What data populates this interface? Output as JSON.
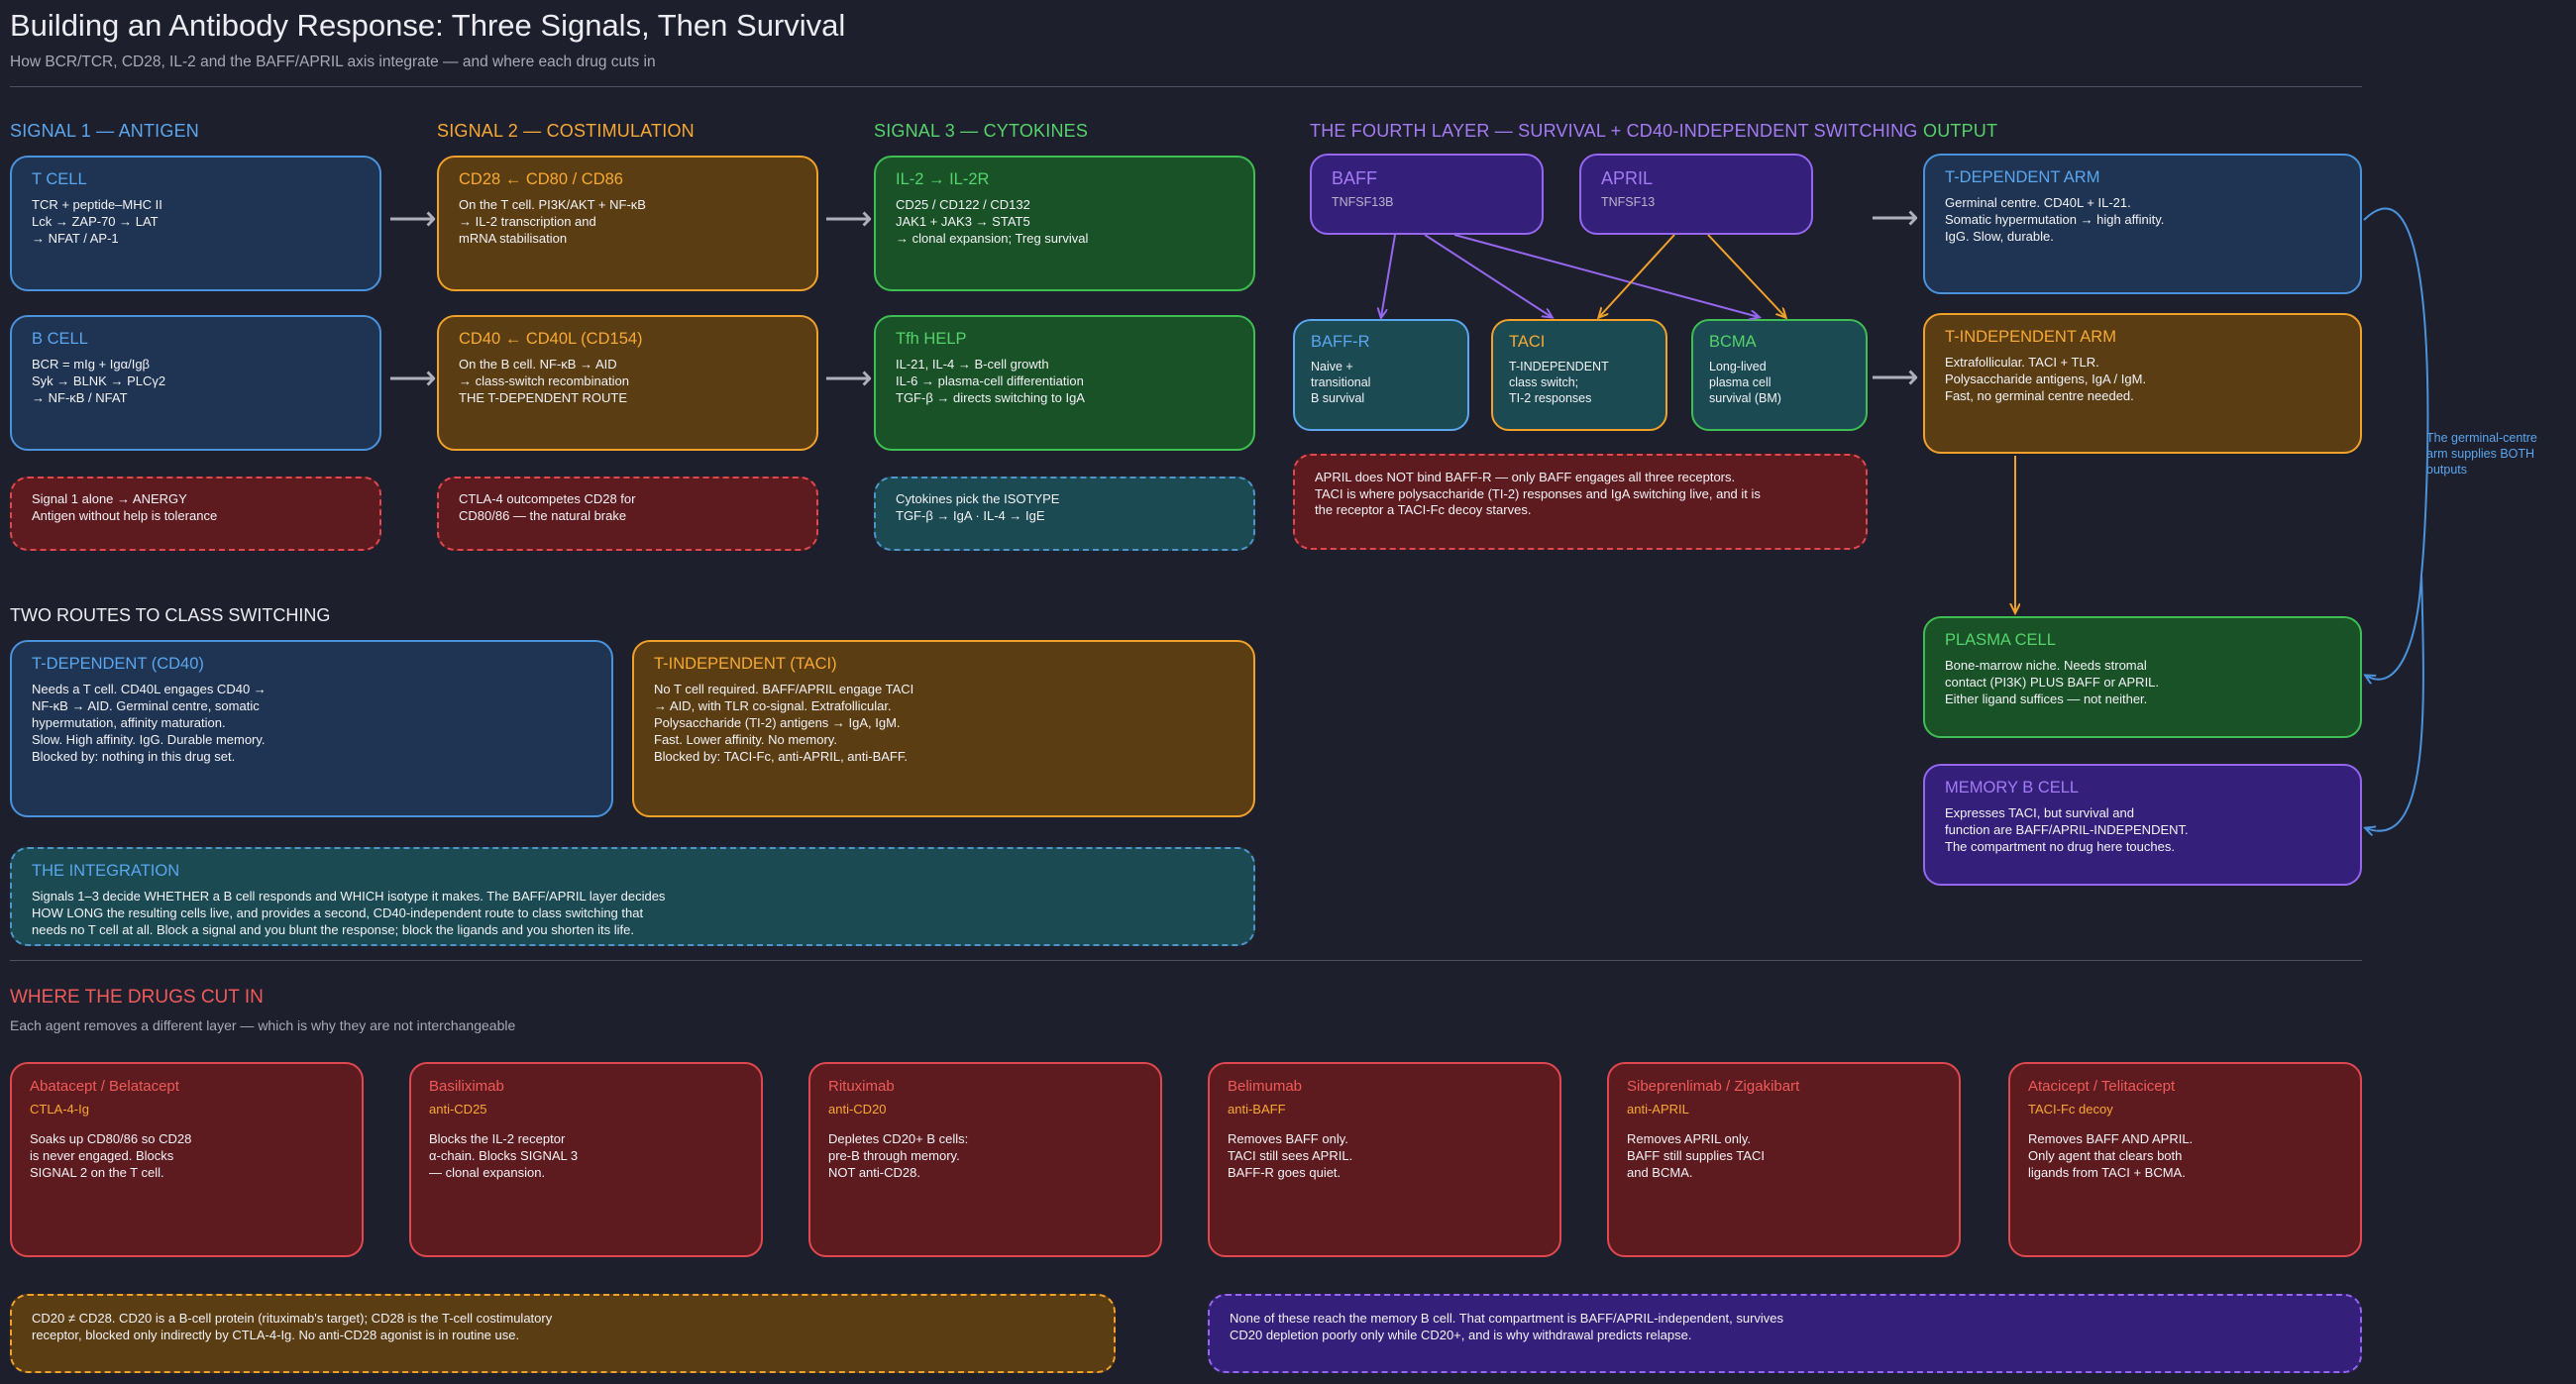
{
  "header": {
    "title": "Building an Antibody Response: Three Signals, Then Survival",
    "subtitle": "How BCR/TCR, CD28, IL-2 and the BAFF/APRIL axis integrate — and where each drug cuts in"
  },
  "columns": {
    "signal1": "SIGNAL 1 — ANTIGEN",
    "signal2": "SIGNAL 2 — COSTIMULATION",
    "signal3": "SIGNAL 3 — CYTOKINES",
    "fourth": "THE FOURTH LAYER — SURVIVAL + CD40-INDEPENDENT SWITCHING",
    "output": "OUTPUT"
  },
  "signal1": {
    "tcell": {
      "title": "T CELL",
      "body": "TCR + peptide–MHC II\nLck → ZAP-70 → LAT\n→ NFAT / AP-1"
    },
    "bcell": {
      "title": "B CELL",
      "body": "BCR = mIg + Igα/Igβ\nSyk → BLNK → PLCγ2\n→ NF-κB / NFAT"
    },
    "note": "Signal 1 alone → ANERGY\nAntigen without help is tolerance"
  },
  "signal2": {
    "cd28": {
      "title": "CD28  ←  CD80 / CD86",
      "body": "On the T cell. PI3K/AKT + NF-κB\n→ IL-2 transcription and\nmRNA stabilisation"
    },
    "cd40": {
      "title": "CD40  ←  CD40L (CD154)",
      "body": "On the B cell. NF-κB → AID\n→ class-switch recombination\nTHE T-DEPENDENT ROUTE"
    },
    "note": "CTLA-4 outcompetes CD28 for\nCD80/86 — the natural brake"
  },
  "signal3": {
    "il2": {
      "title": "IL-2  →  IL-2R",
      "body": "CD25 / CD122 / CD132\nJAK1 + JAK3 → STAT5\n→ clonal expansion; Treg survival"
    },
    "tfh": {
      "title": "Tfh HELP",
      "body": "IL-21, IL-4 → B-cell growth\nIL-6 → plasma-cell differentiation\nTGF-β → directs switching to IgA"
    },
    "note": "Cytokines pick the ISOTYPE\nTGF-β → IgA · IL-4 → IgE"
  },
  "fourth": {
    "baff": {
      "title": "BAFF",
      "sub": "TNFSF13B"
    },
    "april": {
      "title": "APRIL",
      "sub": "TNFSF13"
    },
    "baffr": {
      "title": "BAFF-R",
      "body": "Naive +\ntransitional\nB survival"
    },
    "taci": {
      "title": "TACI",
      "body": "T-INDEPENDENT\nclass switch;\nTI-2 responses"
    },
    "bcma": {
      "title": "BCMA",
      "body": "Long-lived\nplasma cell\nsurvival (BM)"
    },
    "note": "APRIL does NOT bind BAFF-R — only BAFF engages all three receptors.\nTACI is where polysaccharide (TI-2) responses and IgA switching live, and it is\nthe receptor a TACI-Fc decoy starves."
  },
  "output": {
    "tdep": {
      "title": "T-DEPENDENT ARM",
      "body": "Germinal centre. CD40L + IL-21.\nSomatic hypermutation → high affinity.\nIgG. Slow, durable."
    },
    "tindep": {
      "title": "T-INDEPENDENT ARM",
      "body": "Extrafollicular. TACI + TLR.\nPolysaccharide antigens, IgA / IgM.\nFast, no germinal centre needed."
    },
    "plasma": {
      "title": "PLASMA CELL",
      "body": "Bone-marrow niche. Needs stromal\ncontact (PI3K) PLUS BAFF or APRIL.\nEither ligand suffices — not neither."
    },
    "memory": {
      "title": "MEMORY B CELL",
      "body": "Expresses TACI, but survival and\nfunction are BAFF/APRIL-INDEPENDENT.\nThe compartment no drug here touches."
    },
    "side_note": "The germinal-centre\narm supplies BOTH\noutputs"
  },
  "routes": {
    "heading": "TWO ROUTES TO CLASS SWITCHING",
    "tdep": {
      "title": "T-DEPENDENT  (CD40)",
      "body": "Needs a T cell. CD40L engages CD40 →\nNF-κB → AID. Germinal centre, somatic\nhypermutation, affinity maturation.\nSlow. High affinity. IgG. Durable memory.\nBlocked by: nothing in this drug set."
    },
    "tindep": {
      "title": "T-INDEPENDENT  (TACI)",
      "body": "No T cell required. BAFF/APRIL engage TACI\n→ AID, with TLR co-signal. Extrafollicular.\nPolysaccharide (TI-2) antigens → IgA, IgM.\nFast. Lower affinity. No memory.\nBlocked by: TACI-Fc, anti-APRIL, anti-BAFF."
    },
    "integration": {
      "title": "THE INTEGRATION",
      "body": "Signals 1–3 decide WHETHER a B cell responds and WHICH isotype it makes. The BAFF/APRIL layer decides\nHOW LONG the resulting cells live, and provides a second, CD40-independent route to class switching that\nneeds no T cell at all. Block a signal and you blunt the response; block the ligands and you shorten its life."
    }
  },
  "drugs": {
    "heading": "WHERE THE DRUGS CUT IN",
    "subheading": "Each agent removes a different layer — which is why they are not interchangeable",
    "items": [
      {
        "name": "Abatacept / Belatacept",
        "target": "CTLA-4-Ig",
        "desc": "Soaks up CD80/86 so CD28\nis never engaged. Blocks\nSIGNAL 2 on the T cell."
      },
      {
        "name": "Basiliximab",
        "target": "anti-CD25",
        "desc": "Blocks the IL-2 receptor\nα-chain. Blocks SIGNAL 3\n— clonal expansion."
      },
      {
        "name": "Rituximab",
        "target": "anti-CD20",
        "desc": "Depletes CD20+ B cells:\npre-B through memory.\nNOT anti-CD28."
      },
      {
        "name": "Belimumab",
        "target": "anti-BAFF",
        "desc": "Removes BAFF only.\nTACI still sees APRIL.\nBAFF-R goes quiet."
      },
      {
        "name": "Sibeprenlimab / Zigakibart",
        "target": "anti-APRIL",
        "desc": "Removes APRIL only.\nBAFF still supplies TACI\nand BCMA."
      },
      {
        "name": "Atacicept / Telitacicept",
        "target": "TACI-Fc decoy",
        "desc": "Removes BAFF AND APRIL.\nOnly agent that clears both\nligands from TACI + BCMA."
      }
    ],
    "footnote_left": "CD20 ≠ CD28.  CD20 is a B-cell protein (rituximab's target); CD28 is the T-cell costimulatory\nreceptor, blocked only indirectly by CTLA-4-Ig. No anti-CD28 agonist is in routine use.",
    "footnote_right": "None of these reach the memory B cell. That compartment is BAFF/APRIL-independent, survives\nCD20 depletion poorly only while CD20+, and is why withdrawal predicts relapse."
  },
  "colors": {
    "blue": "#4a93dc",
    "orange": "#f0a12a",
    "green": "#3fbe54",
    "purple": "#9467ee",
    "red": "#e0484f",
    "teal": "#1b4a52"
  }
}
